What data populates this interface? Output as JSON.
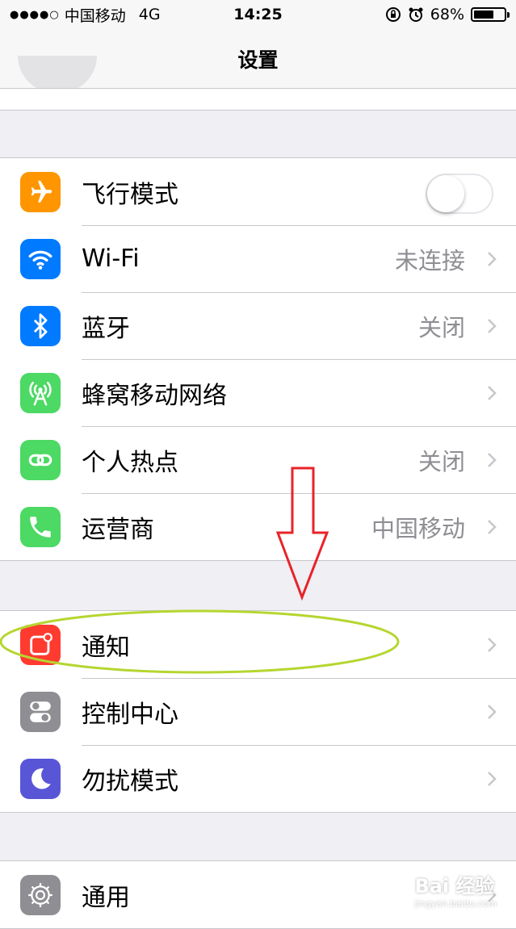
{
  "statusbar": {
    "carrier": "中国移动",
    "network": "4G",
    "time": "14:25",
    "battery": "68%",
    "battery_level": 0.68
  },
  "navbar": {
    "title": "设置"
  },
  "groups": [
    {
      "items": [
        {
          "label": "飞行模式",
          "value": "",
          "icon": "airplane-icon",
          "color": "#ff9500",
          "toggle": false
        },
        {
          "label": "Wi-Fi",
          "value": "未连接",
          "icon": "wifi-icon",
          "color": "#007aff"
        },
        {
          "label": "蓝牙",
          "value": "关闭",
          "icon": "bluetooth-icon",
          "color": "#007aff"
        },
        {
          "label": "蜂窝移动网络",
          "value": "",
          "icon": "cellular-antenna-icon",
          "color": "#4cd964"
        },
        {
          "label": "个人热点",
          "value": "关闭",
          "icon": "hotspot-link-icon",
          "color": "#4cd964"
        },
        {
          "label": "运营商",
          "value": "中国移动",
          "icon": "phone-icon",
          "color": "#4cd964"
        }
      ]
    },
    {
      "items": [
        {
          "label": "通知",
          "value": "",
          "icon": "notifications-icon",
          "color": "#ff3b30"
        },
        {
          "label": "控制中心",
          "value": "",
          "icon": "control-center-icon",
          "color": "#8e8e93"
        },
        {
          "label": "勿扰模式",
          "value": "",
          "icon": "moon-icon",
          "color": "#5856d6"
        }
      ]
    },
    {
      "items": [
        {
          "label": "通用",
          "value": "",
          "icon": "gear-icon",
          "color": "#8e8e93"
        }
      ]
    }
  ],
  "annotations": {
    "arrow_color": "#e8232a",
    "ellipse_color": "#b5d630"
  },
  "watermark": {
    "brand": "Bai 经验",
    "url": "jingyan.baidu.com"
  }
}
